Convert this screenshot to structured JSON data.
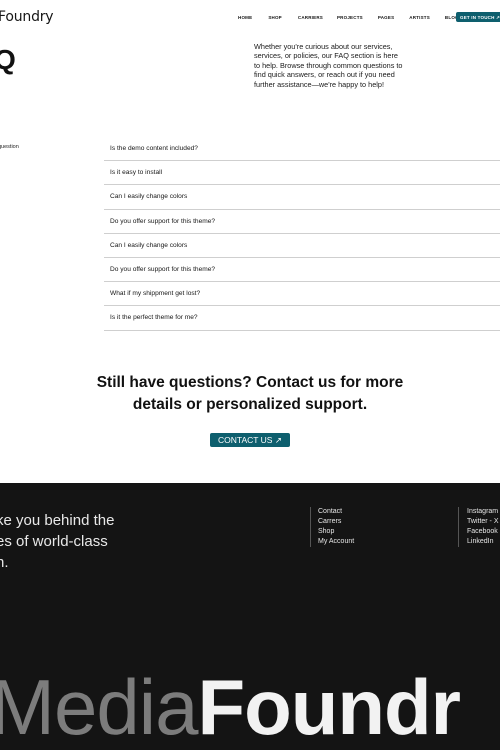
{
  "header": {
    "logo": "Foundry",
    "nav": [
      "HOME",
      "SHOP",
      "CARRIERS",
      "PROJECTS",
      "PAGES",
      "ARTISTS",
      "BLOG"
    ],
    "cta": "GET IN TOUCH ↗"
  },
  "faq": {
    "title": "Q",
    "intro": "Whether you're curious about our services, services, or policies, our FAQ section is here to help. Browse through common questions to find quick answers, or reach out if you need further assistance—we're happy to help!",
    "side_label": "question",
    "items": [
      "Is the demo content included?",
      "Is it easy to install",
      "Can I easily change colors",
      "Do you offer support for this theme?",
      "Can I easily change colors",
      "Do you offer support for this theme?",
      "What if my shippment get lost?",
      "Is it the perfect theme for me?"
    ]
  },
  "contact": {
    "heading_line1": "Still have questions? Contact us for more",
    "heading_line2": "details or personalized support.",
    "button": "CONTACT US ↗"
  },
  "footer": {
    "tagline_lines": [
      "ke you behind the",
      "es of world-class",
      "n."
    ],
    "links": [
      "Contact",
      "Carrers",
      "Shop",
      "My Account"
    ],
    "social": [
      "Instagram",
      "Twitter - X",
      "Facebook",
      "LinkedIn"
    ],
    "brand_light": "Media",
    "brand_bold": "Foundr"
  }
}
